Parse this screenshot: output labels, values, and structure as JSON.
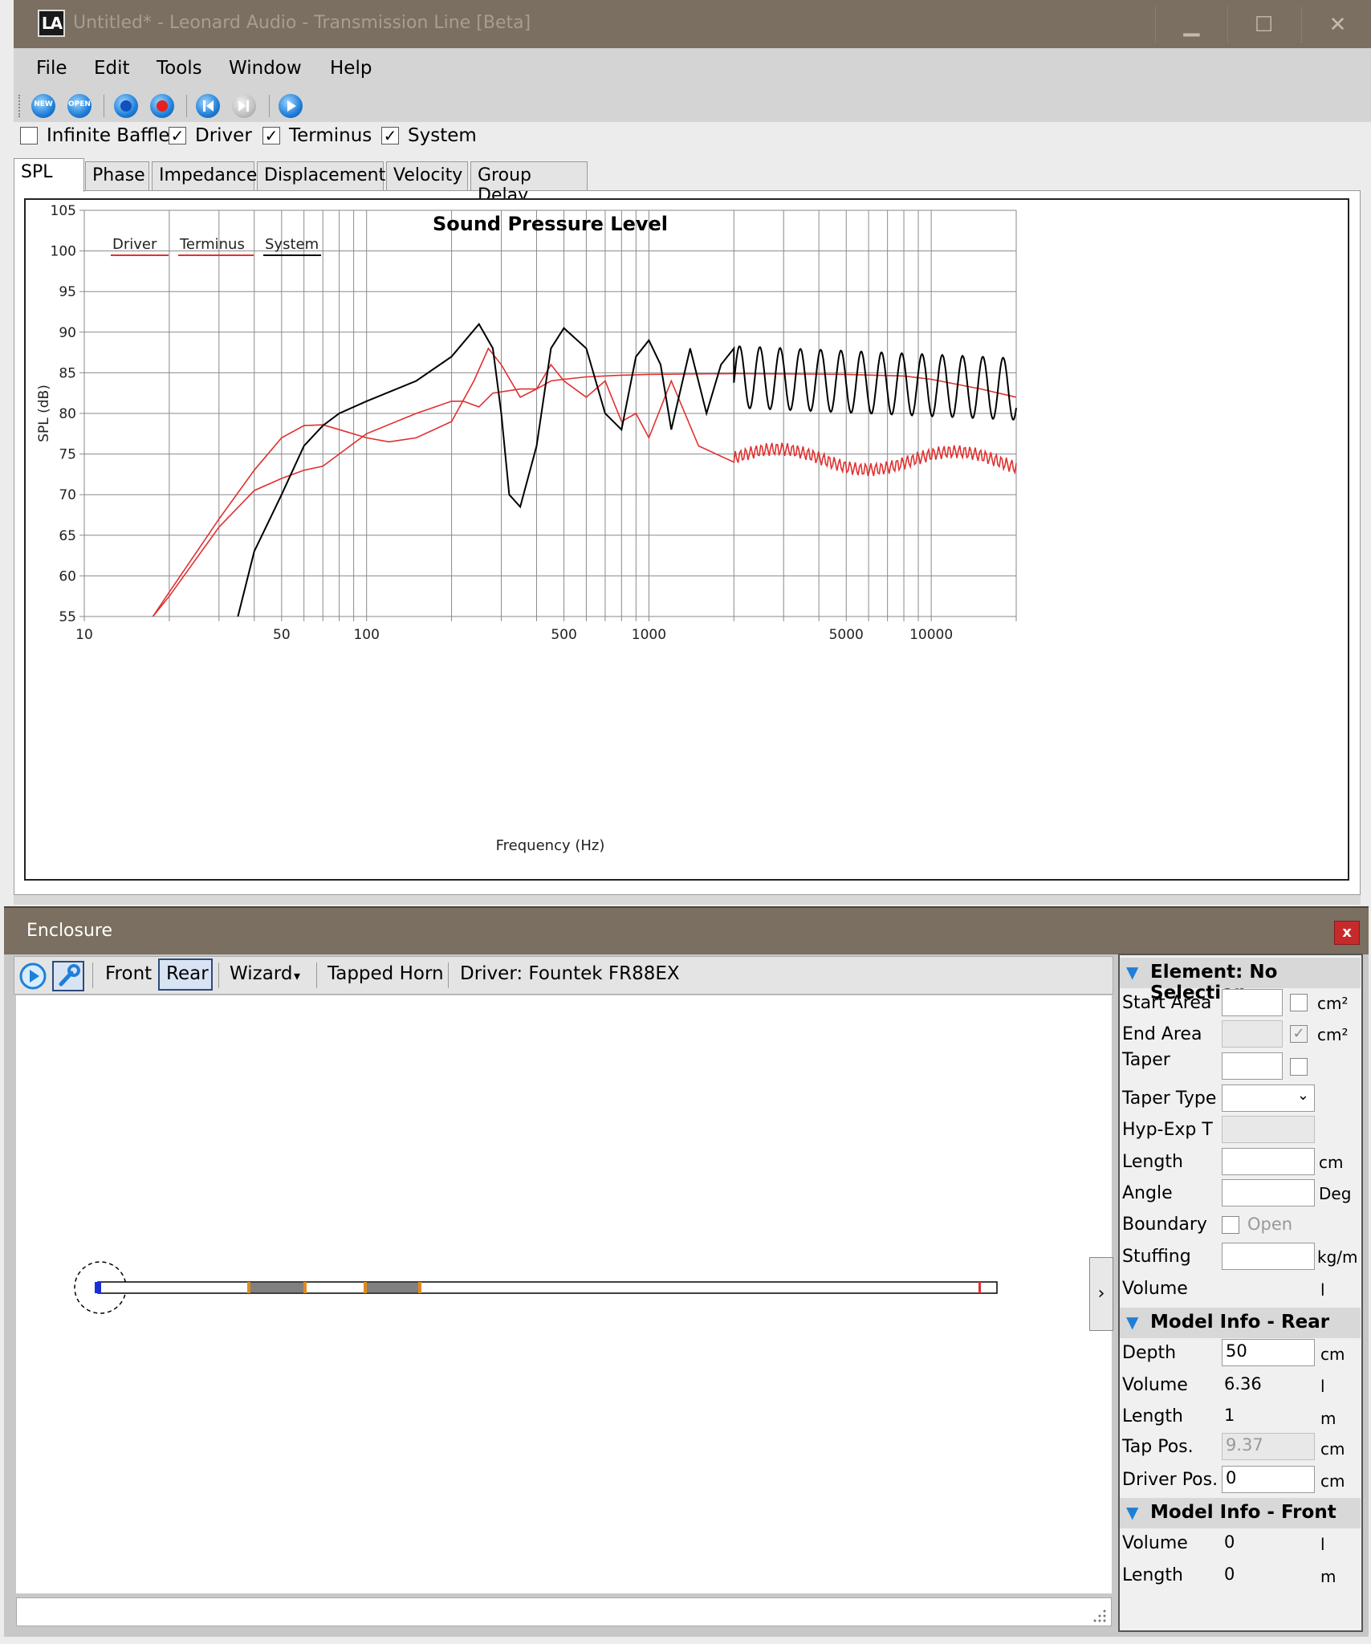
{
  "window": {
    "title": "Untitled* - Leonard Audio - Transmission Line [Beta]",
    "logo_text": "LA",
    "min": "▁",
    "max": "☐",
    "close": "✕"
  },
  "menu": {
    "items": [
      "File",
      "Edit",
      "Tools",
      "Window",
      "Help"
    ]
  },
  "toolbar": {
    "new_label": "NEW",
    "open_label": "OPEN"
  },
  "checks": [
    {
      "label": "Infinite Baffle",
      "checked": false
    },
    {
      "label": "Driver",
      "checked": true
    },
    {
      "label": "Terminus",
      "checked": true
    },
    {
      "label": "System",
      "checked": true
    }
  ],
  "tabs": [
    "SPL",
    "Phase",
    "Impedance",
    "Displacement",
    "Velocity",
    "Group Delay"
  ],
  "active_tab": "SPL",
  "chart_data": {
    "type": "line",
    "title": "Sound Pressure Level",
    "xlabel": "Frequency (Hz)",
    "ylabel": "SPL (dB)",
    "x_scale": "log",
    "xlim": [
      10,
      20000
    ],
    "ylim": [
      55,
      105
    ],
    "x_ticks": [
      10,
      50,
      100,
      500,
      1000,
      5000,
      10000
    ],
    "y_ticks": [
      55,
      60,
      65,
      70,
      75,
      80,
      85,
      90,
      95,
      100,
      105
    ],
    "grid": true,
    "legend": [
      "Driver",
      "Terminus",
      "System"
    ],
    "legend_position": "top-left",
    "colors": {
      "Driver": "#e03030",
      "Terminus": "#e03030",
      "System": "#000000"
    },
    "series": [
      {
        "name": "Driver",
        "color": "#e03030",
        "points": [
          [
            17.5,
            55
          ],
          [
            20,
            57.5
          ],
          [
            30,
            66
          ],
          [
            40,
            70.5
          ],
          [
            50,
            72
          ],
          [
            60,
            73
          ],
          [
            70,
            73.5
          ],
          [
            80,
            75
          ],
          [
            100,
            77.5
          ],
          [
            150,
            80
          ],
          [
            200,
            81.5
          ],
          [
            220,
            81.5
          ],
          [
            250,
            80.8
          ],
          [
            280,
            82.5
          ],
          [
            350,
            83
          ],
          [
            400,
            83
          ],
          [
            450,
            84
          ],
          [
            500,
            84.2
          ],
          [
            600,
            84.5
          ],
          [
            800,
            84.7
          ],
          [
            1000,
            84.8
          ],
          [
            2000,
            84.9
          ],
          [
            5000,
            84.8
          ],
          [
            8000,
            84.6
          ],
          [
            10000,
            84.2
          ],
          [
            15000,
            83
          ],
          [
            20000,
            82
          ]
        ]
      },
      {
        "name": "Terminus",
        "color": "#e03030",
        "points": [
          [
            17.5,
            55
          ],
          [
            20,
            58
          ],
          [
            30,
            67
          ],
          [
            40,
            73
          ],
          [
            50,
            77
          ],
          [
            60,
            78.5
          ],
          [
            70,
            78.6
          ],
          [
            80,
            78
          ],
          [
            100,
            77
          ],
          [
            120,
            76.5
          ],
          [
            150,
            77
          ],
          [
            200,
            79
          ],
          [
            240,
            84
          ],
          [
            270,
            88
          ],
          [
            300,
            86
          ],
          [
            350,
            82
          ],
          [
            400,
            83
          ],
          [
            450,
            86
          ],
          [
            500,
            84
          ],
          [
            600,
            82
          ],
          [
            700,
            84
          ],
          [
            800,
            79
          ],
          [
            900,
            80
          ],
          [
            1000,
            77
          ],
          [
            1200,
            84
          ],
          [
            1500,
            76
          ],
          [
            2000,
            74
          ],
          [
            3000,
            74
          ],
          [
            5000,
            75.5
          ],
          [
            8000,
            74.5
          ],
          [
            10000,
            74
          ],
          [
            15000,
            75
          ],
          [
            20000,
            75
          ]
        ]
      },
      {
        "name": "System",
        "color": "#000000",
        "points": [
          [
            35,
            55
          ],
          [
            40,
            63
          ],
          [
            50,
            70
          ],
          [
            60,
            76
          ],
          [
            70,
            78.5
          ],
          [
            80,
            80
          ],
          [
            100,
            81.5
          ],
          [
            150,
            84
          ],
          [
            200,
            87
          ],
          [
            250,
            91
          ],
          [
            280,
            88
          ],
          [
            300,
            80
          ],
          [
            320,
            70
          ],
          [
            350,
            68.5
          ],
          [
            400,
            76
          ],
          [
            450,
            88
          ],
          [
            500,
            90.5
          ],
          [
            600,
            88
          ],
          [
            700,
            80
          ],
          [
            800,
            78
          ],
          [
            900,
            87
          ],
          [
            1000,
            89
          ],
          [
            1100,
            86
          ],
          [
            1200,
            78
          ],
          [
            1400,
            88
          ],
          [
            1600,
            80
          ],
          [
            1800,
            86
          ],
          [
            2000,
            88
          ],
          [
            20000,
            83
          ]
        ]
      }
    ]
  },
  "enclosure": {
    "title": "Enclosure",
    "close": "x",
    "toolbar": {
      "front": "Front",
      "rear": "Rear",
      "wizard": "Wizard",
      "wizard_arrow": "▾",
      "tapped_horn": "Tapped Horn",
      "driver": "Driver: Fountek FR88EX"
    },
    "side_tab": "›"
  },
  "properties": {
    "element_header": "Element: No Selection",
    "element_fields": [
      {
        "label": "Start Area",
        "value": "",
        "unit": "cm²"
      },
      {
        "label": "End Area",
        "value": "",
        "unit": "cm²"
      },
      {
        "label": "Taper",
        "value": "",
        "unit": ""
      },
      {
        "label": "Taper Type",
        "value": "",
        "unit": ""
      },
      {
        "label": "Hyp-Exp T",
        "value": "",
        "unit": ""
      },
      {
        "label": "Length",
        "value": "",
        "unit": "cm"
      },
      {
        "label": "Angle",
        "value": "",
        "unit": "Deg"
      },
      {
        "label": "Boundary",
        "value": "Open",
        "unit": ""
      },
      {
        "label": "Stuffing",
        "value": "",
        "unit": "kg/m"
      },
      {
        "label": "Volume",
        "value": "",
        "unit": "l"
      }
    ],
    "rear_header": "Model Info - Rear",
    "rear_fields": [
      {
        "label": "Depth",
        "value": "50",
        "unit": "cm"
      },
      {
        "label": "Volume",
        "value": "6.36",
        "unit": "l"
      },
      {
        "label": "Length",
        "value": "1",
        "unit": "m"
      },
      {
        "label": "Tap Pos.",
        "value": "9.37",
        "unit": "cm"
      },
      {
        "label": "Driver Pos.",
        "value": "0",
        "unit": "cm"
      }
    ],
    "front_header": "Model Info - Front",
    "front_fields": [
      {
        "label": "Volume",
        "value": "0",
        "unit": "l"
      },
      {
        "label": "Length",
        "value": "0",
        "unit": "m"
      }
    ]
  }
}
